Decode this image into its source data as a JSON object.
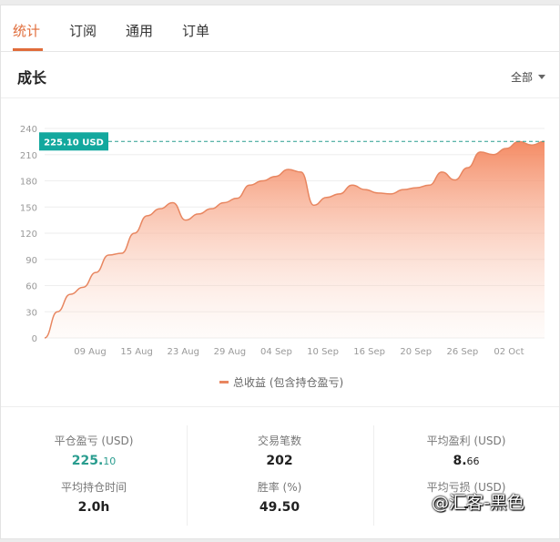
{
  "tabs": [
    {
      "label": "统计",
      "active": true
    },
    {
      "label": "订阅",
      "active": false
    },
    {
      "label": "通用",
      "active": false
    },
    {
      "label": "订单",
      "active": false
    }
  ],
  "section": {
    "title": "成长",
    "range_label": "全部"
  },
  "chart_data": {
    "type": "area",
    "title": "",
    "xlabel": "",
    "ylabel": "",
    "ylim": [
      0,
      240
    ],
    "y_ticks": [
      "0",
      "30",
      "60",
      "90",
      "120",
      "150",
      "180",
      "210",
      "240"
    ],
    "x_tick_labels": [
      "09 Aug",
      "15 Aug",
      "23 Aug",
      "29 Aug",
      "04 Sep",
      "10 Sep",
      "16 Sep",
      "20 Sep",
      "26 Sep",
      "02 Oct"
    ],
    "grid": true,
    "legend_position": "bottom-center",
    "series": [
      {
        "name": "总收益 (包含持仓盈亏)",
        "color": "#e88660",
        "values": [
          0,
          30,
          50,
          58,
          75,
          95,
          97,
          120,
          140,
          148,
          155,
          135,
          142,
          148,
          155,
          160,
          175,
          180,
          185,
          193,
          190,
          152,
          161,
          165,
          175,
          170,
          166,
          165,
          170,
          172,
          175,
          190,
          181,
          195,
          213,
          210,
          217,
          225,
          221,
          225.1
        ]
      }
    ],
    "current_value_label": "225.10 USD",
    "current_value": 225.1
  },
  "stats": {
    "closed_pnl": {
      "label": "平仓盈亏 (USD)",
      "int": "225.",
      "dec": "10"
    },
    "trade_count": {
      "label": "交易笔数",
      "value": "202"
    },
    "avg_profit": {
      "label": "平均盈利 (USD)",
      "int": "8.",
      "dec": "66"
    },
    "avg_hold_time": {
      "label": "平均持仓时间",
      "value": "2.0h"
    },
    "win_rate": {
      "label": "胜率 (%)",
      "value": "49.50"
    },
    "avg_loss": {
      "label": "平均亏损 (USD)",
      "value": "-"
    }
  },
  "watermark": "@汇客-黑色"
}
